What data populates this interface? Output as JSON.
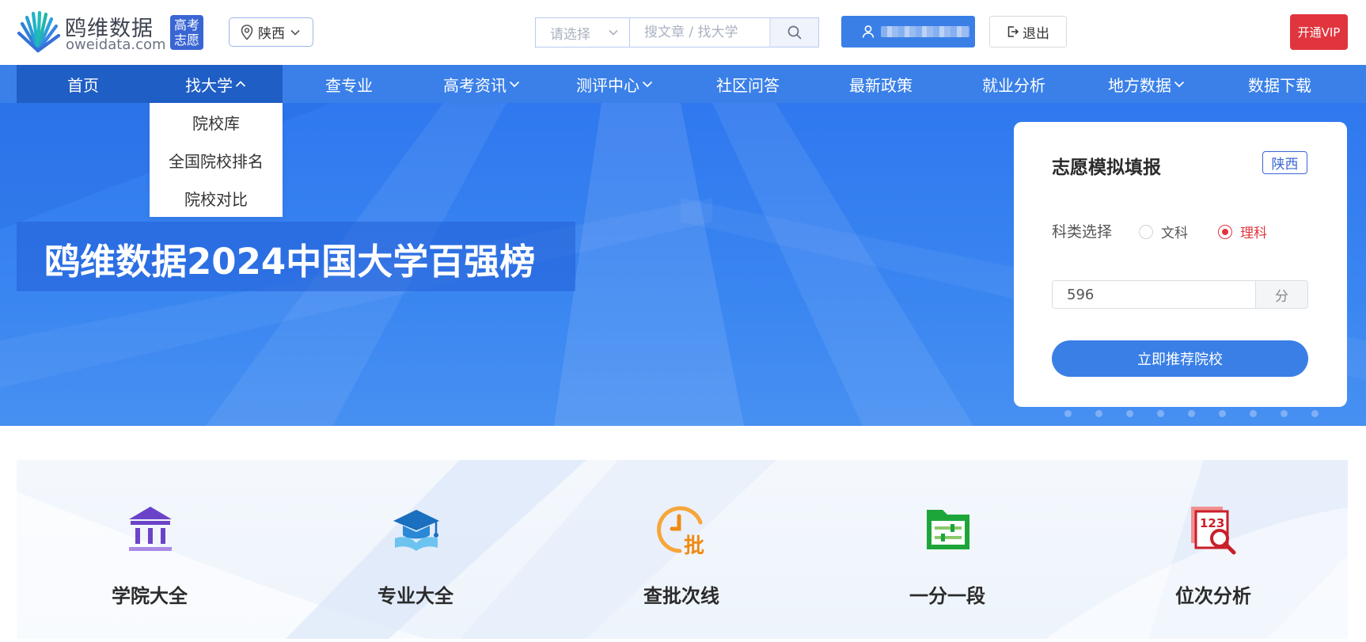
{
  "logo": {
    "title": "鸥维数据",
    "url": "oweidata.com",
    "badge_line1": "高考",
    "badge_line2": "志愿"
  },
  "header": {
    "province": "陕西",
    "search_select_placeholder": "请选择",
    "search_placeholder": "搜文章 / 找大学",
    "logout_label": "退出",
    "vip_label": "开通VIP"
  },
  "nav": {
    "items": [
      {
        "label": "首页",
        "dropdown": false
      },
      {
        "label": "找大学",
        "dropdown": true
      },
      {
        "label": "查专业",
        "dropdown": false
      },
      {
        "label": "高考资讯",
        "dropdown": true
      },
      {
        "label": "测评中心",
        "dropdown": true
      },
      {
        "label": "社区问答",
        "dropdown": false
      },
      {
        "label": "最新政策",
        "dropdown": false
      },
      {
        "label": "就业分析",
        "dropdown": false
      },
      {
        "label": "地方数据",
        "dropdown": true
      },
      {
        "label": "数据下载",
        "dropdown": false
      }
    ],
    "dropdown_items": [
      "院校库",
      "全国院校排名",
      "院校对比"
    ]
  },
  "banner": {
    "headline": "鸥维数据2024中国大学百强榜",
    "dot_count": 9
  },
  "sim_card": {
    "title": "志愿模拟填报",
    "province": "陕西",
    "subject_label": "科类选择",
    "option_liberal": "文科",
    "option_science": "理科",
    "selected": "理科",
    "score": "596",
    "score_unit": "分",
    "submit_label": "立即推荐院校"
  },
  "tools": [
    {
      "label": "学院大全",
      "icon": "university-building-icon"
    },
    {
      "label": "专业大全",
      "icon": "graduation-cap-book-icon"
    },
    {
      "label": "查批次线",
      "icon": "batch-clock-icon"
    },
    {
      "label": "一分一段",
      "icon": "folder-sliders-icon"
    },
    {
      "label": "位次分析",
      "icon": "rank-magnifier-icon"
    }
  ],
  "colors": {
    "primary": "#3a80e8",
    "nav_active": "#1f5ec4",
    "vip_red": "#e0353e",
    "badge_blue": "#3a66d4"
  }
}
